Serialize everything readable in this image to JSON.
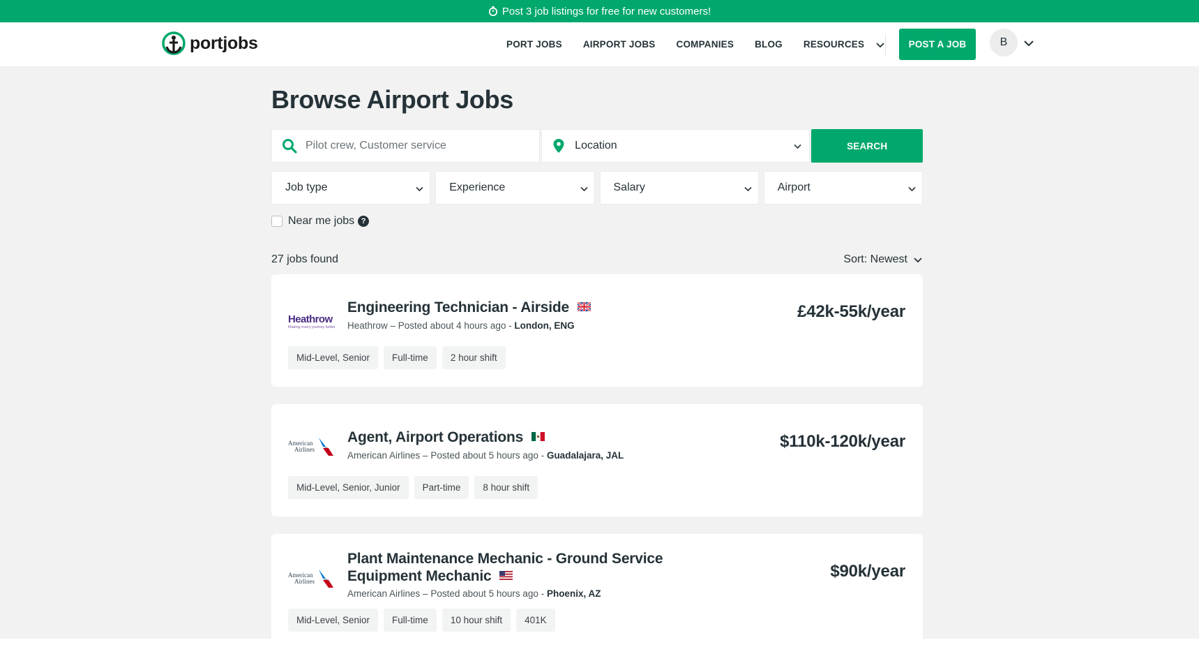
{
  "promo": {
    "text": "Post 3 job listings for free for new customers!"
  },
  "header": {
    "logo_text": "portjobs",
    "nav": [
      "PORT JOBS",
      "AIRPORT JOBS",
      "COMPANIES",
      "BLOG",
      "RESOURCES"
    ],
    "post_job_label": "POST A JOB",
    "avatar_initial": "B"
  },
  "page": {
    "title": "Browse Airport Jobs"
  },
  "search": {
    "keyword_placeholder": "Pilot crew, Customer service",
    "location_label": "Location",
    "button_label": "SEARCH"
  },
  "filters": [
    "Job type",
    "Experience",
    "Salary",
    "Airport"
  ],
  "near_me_label": "Near me jobs",
  "help_glyph": "?",
  "results": {
    "count_label": "27 jobs found",
    "sort_label": "Sort: Newest"
  },
  "jobs": [
    {
      "title": "Engineering Technician - Airside",
      "company": "Heathrow",
      "posted": "Posted about 4 hours ago",
      "location": "London, ENG",
      "salary": "£42k-55k/year",
      "tags": [
        "Mid-Level, Senior",
        "Full-time",
        "2 hour shift"
      ],
      "logo_text": "Heathrow",
      "logo_subtext": "Making every journey better",
      "flag": "uk-flag-icon"
    },
    {
      "title": "Agent, Airport Operations",
      "company": "American Airlines",
      "posted": "Posted about 5 hours ago",
      "location": "Guadalajara, JAL",
      "salary": "$110k-120k/year",
      "tags": [
        "Mid-Level, Senior, Junior",
        "Part-time",
        "8 hour shift"
      ],
      "logo_text_1": "American",
      "logo_text_2": "Airlines",
      "flag": "mexico-flag-icon"
    },
    {
      "title_line1": "Plant Maintenance Mechanic - Ground Service",
      "title_line2": "Equipment Mechanic",
      "company": "American Airlines",
      "posted": "Posted about 5 hours ago",
      "location": "Phoenix, AZ",
      "salary": "$90k/year",
      "tags": [
        "Mid-Level, Senior",
        "Full-time",
        "10 hour shift",
        "401K"
      ],
      "logo_text_1": "American",
      "logo_text_2": "Airlines",
      "flag": "us-flag-icon"
    }
  ],
  "separator": " – ",
  "separator2": " - ",
  "colors": {
    "brand": "#00a86b",
    "text": "#253238",
    "background": "#f2f2f2"
  }
}
